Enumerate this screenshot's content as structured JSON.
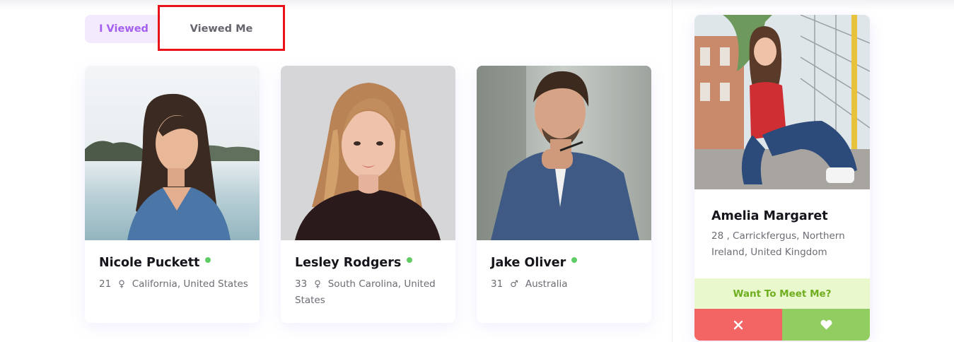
{
  "tabs": {
    "i_viewed": "I Viewed",
    "viewed_me": "Viewed Me"
  },
  "profiles": [
    {
      "name": "Nicole Puckett",
      "age": "21",
      "gender_icon": "female-icon",
      "location": "California, United States",
      "online": true
    },
    {
      "name": "Lesley Rodgers",
      "age": "33",
      "gender_icon": "female-icon",
      "location": "South Carolina, United States",
      "online": true
    },
    {
      "name": "Jake Oliver",
      "age": "31",
      "gender_icon": "male-icon",
      "location": "Australia",
      "online": true
    }
  ],
  "featured": {
    "name": "Amelia Margaret",
    "details": "28 , Carrickfergus, Northern Ireland, United Kingdom",
    "prompt": "Want To Meet Me?",
    "decline_icon": "close-icon",
    "like_icon": "heart-icon"
  },
  "colors": {
    "accent": "#a45ef0",
    "online": "#5fcc66",
    "decline": "#f36464",
    "like": "#91cd60",
    "highlight": "#e8121a"
  }
}
